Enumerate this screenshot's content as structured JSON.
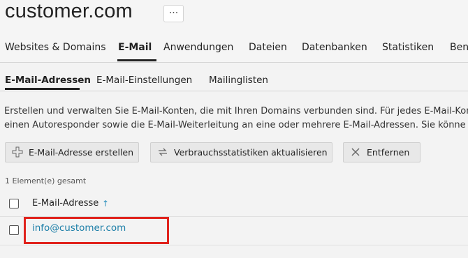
{
  "header": {
    "title": "customer.com",
    "more_label": "···"
  },
  "main_tabs": [
    {
      "label": "Websites & Domains"
    },
    {
      "label": "E-Mail"
    },
    {
      "label": "Anwendungen"
    },
    {
      "label": "Dateien"
    },
    {
      "label": "Datenbanken"
    },
    {
      "label": "Statistiken"
    },
    {
      "label": "Ben"
    }
  ],
  "sub_tabs": [
    {
      "label": "E-Mail-Adressen"
    },
    {
      "label": "E-Mail-Einstellungen"
    },
    {
      "label": "Mailinglisten"
    }
  ],
  "description": {
    "line1": "Erstellen und verwalten Sie E-Mail-Konten, die mit Ihren Domains verbunden sind. Für jedes E-Mail-Kon",
    "line2": "einen Autoresponder sowie die E-Mail-Weiterleitung an eine oder mehrere E-Mail-Adressen. Sie könne"
  },
  "toolbar": {
    "create_label": "E-Mail-Adresse erstellen",
    "refresh_label": "Verbrauchsstatistiken aktualisieren",
    "remove_label": "Entfernen"
  },
  "table": {
    "count_text": "1 Element(e) gesamt",
    "column_header": "E-Mail-Adresse",
    "sort_icon": "↑",
    "rows": [
      {
        "email": "info@customer.com"
      }
    ]
  },
  "colors": {
    "link": "#1d7fa8",
    "highlight": "#e0231d"
  }
}
